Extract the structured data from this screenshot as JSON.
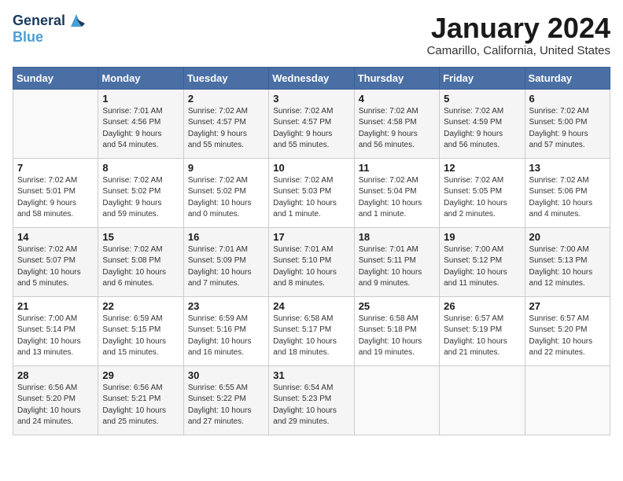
{
  "header": {
    "logo_line1": "General",
    "logo_line2": "Blue",
    "month": "January 2024",
    "location": "Camarillo, California, United States"
  },
  "weekdays": [
    "Sunday",
    "Monday",
    "Tuesday",
    "Wednesday",
    "Thursday",
    "Friday",
    "Saturday"
  ],
  "weeks": [
    [
      {
        "day": "",
        "info": ""
      },
      {
        "day": "1",
        "info": "Sunrise: 7:01 AM\nSunset: 4:56 PM\nDaylight: 9 hours\nand 54 minutes."
      },
      {
        "day": "2",
        "info": "Sunrise: 7:02 AM\nSunset: 4:57 PM\nDaylight: 9 hours\nand 55 minutes."
      },
      {
        "day": "3",
        "info": "Sunrise: 7:02 AM\nSunset: 4:57 PM\nDaylight: 9 hours\nand 55 minutes."
      },
      {
        "day": "4",
        "info": "Sunrise: 7:02 AM\nSunset: 4:58 PM\nDaylight: 9 hours\nand 56 minutes."
      },
      {
        "day": "5",
        "info": "Sunrise: 7:02 AM\nSunset: 4:59 PM\nDaylight: 9 hours\nand 56 minutes."
      },
      {
        "day": "6",
        "info": "Sunrise: 7:02 AM\nSunset: 5:00 PM\nDaylight: 9 hours\nand 57 minutes."
      }
    ],
    [
      {
        "day": "7",
        "info": "Sunrise: 7:02 AM\nSunset: 5:01 PM\nDaylight: 9 hours\nand 58 minutes."
      },
      {
        "day": "8",
        "info": "Sunrise: 7:02 AM\nSunset: 5:02 PM\nDaylight: 9 hours\nand 59 minutes."
      },
      {
        "day": "9",
        "info": "Sunrise: 7:02 AM\nSunset: 5:02 PM\nDaylight: 10 hours\nand 0 minutes."
      },
      {
        "day": "10",
        "info": "Sunrise: 7:02 AM\nSunset: 5:03 PM\nDaylight: 10 hours\nand 1 minute."
      },
      {
        "day": "11",
        "info": "Sunrise: 7:02 AM\nSunset: 5:04 PM\nDaylight: 10 hours\nand 1 minute."
      },
      {
        "day": "12",
        "info": "Sunrise: 7:02 AM\nSunset: 5:05 PM\nDaylight: 10 hours\nand 2 minutes."
      },
      {
        "day": "13",
        "info": "Sunrise: 7:02 AM\nSunset: 5:06 PM\nDaylight: 10 hours\nand 4 minutes."
      }
    ],
    [
      {
        "day": "14",
        "info": "Sunrise: 7:02 AM\nSunset: 5:07 PM\nDaylight: 10 hours\nand 5 minutes."
      },
      {
        "day": "15",
        "info": "Sunrise: 7:02 AM\nSunset: 5:08 PM\nDaylight: 10 hours\nand 6 minutes."
      },
      {
        "day": "16",
        "info": "Sunrise: 7:01 AM\nSunset: 5:09 PM\nDaylight: 10 hours\nand 7 minutes."
      },
      {
        "day": "17",
        "info": "Sunrise: 7:01 AM\nSunset: 5:10 PM\nDaylight: 10 hours\nand 8 minutes."
      },
      {
        "day": "18",
        "info": "Sunrise: 7:01 AM\nSunset: 5:11 PM\nDaylight: 10 hours\nand 9 minutes."
      },
      {
        "day": "19",
        "info": "Sunrise: 7:00 AM\nSunset: 5:12 PM\nDaylight: 10 hours\nand 11 minutes."
      },
      {
        "day": "20",
        "info": "Sunrise: 7:00 AM\nSunset: 5:13 PM\nDaylight: 10 hours\nand 12 minutes."
      }
    ],
    [
      {
        "day": "21",
        "info": "Sunrise: 7:00 AM\nSunset: 5:14 PM\nDaylight: 10 hours\nand 13 minutes."
      },
      {
        "day": "22",
        "info": "Sunrise: 6:59 AM\nSunset: 5:15 PM\nDaylight: 10 hours\nand 15 minutes."
      },
      {
        "day": "23",
        "info": "Sunrise: 6:59 AM\nSunset: 5:16 PM\nDaylight: 10 hours\nand 16 minutes."
      },
      {
        "day": "24",
        "info": "Sunrise: 6:58 AM\nSunset: 5:17 PM\nDaylight: 10 hours\nand 18 minutes."
      },
      {
        "day": "25",
        "info": "Sunrise: 6:58 AM\nSunset: 5:18 PM\nDaylight: 10 hours\nand 19 minutes."
      },
      {
        "day": "26",
        "info": "Sunrise: 6:57 AM\nSunset: 5:19 PM\nDaylight: 10 hours\nand 21 minutes."
      },
      {
        "day": "27",
        "info": "Sunrise: 6:57 AM\nSunset: 5:20 PM\nDaylight: 10 hours\nand 22 minutes."
      }
    ],
    [
      {
        "day": "28",
        "info": "Sunrise: 6:56 AM\nSunset: 5:20 PM\nDaylight: 10 hours\nand 24 minutes."
      },
      {
        "day": "29",
        "info": "Sunrise: 6:56 AM\nSunset: 5:21 PM\nDaylight: 10 hours\nand 25 minutes."
      },
      {
        "day": "30",
        "info": "Sunrise: 6:55 AM\nSunset: 5:22 PM\nDaylight: 10 hours\nand 27 minutes."
      },
      {
        "day": "31",
        "info": "Sunrise: 6:54 AM\nSunset: 5:23 PM\nDaylight: 10 hours\nand 29 minutes."
      },
      {
        "day": "",
        "info": ""
      },
      {
        "day": "",
        "info": ""
      },
      {
        "day": "",
        "info": ""
      }
    ]
  ]
}
